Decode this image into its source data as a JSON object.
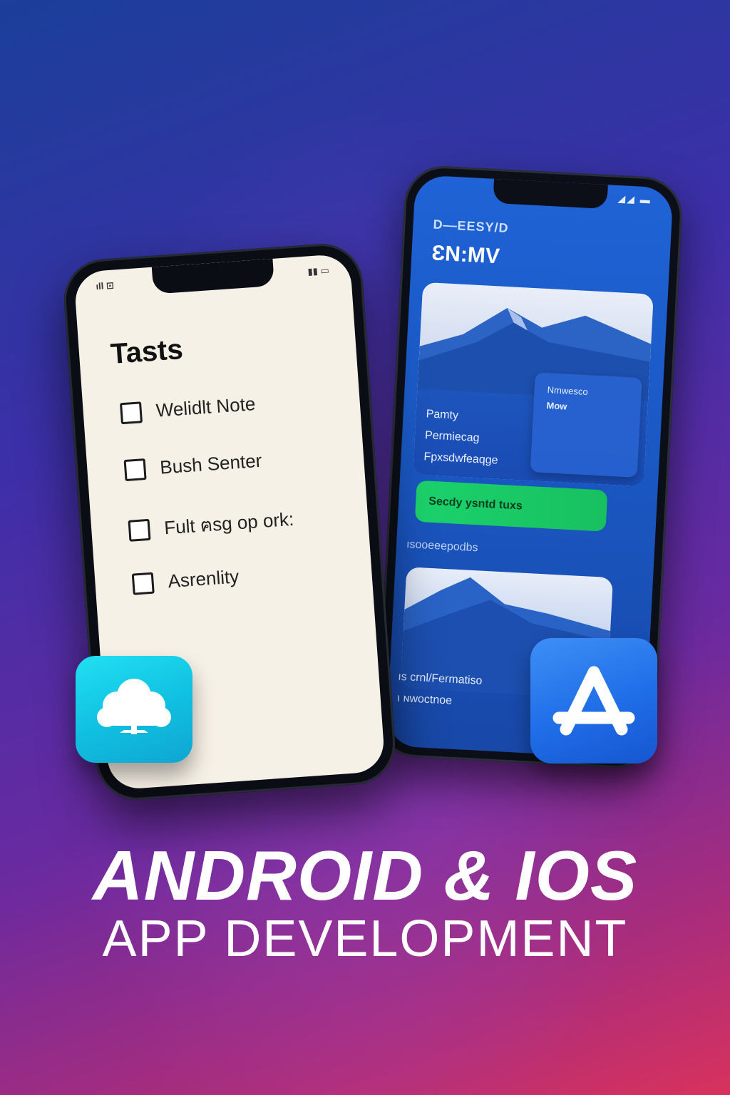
{
  "phone_left": {
    "status_left": "ıll ⊡",
    "status_right": "▮▮ ▭",
    "title": "Tasts",
    "tasks": [
      {
        "label": "Welidlt Note",
        "checked": false
      },
      {
        "label": "Bush Senter",
        "checked": false
      },
      {
        "label": "Fult ฅsg op ork:",
        "checked": false
      },
      {
        "label": "Asrenlity",
        "checked": false
      }
    ]
  },
  "phone_right": {
    "status": "◢◢ ▬",
    "top_label": "D⎯⎯ЕESY/D",
    "title": "ƐN:MV",
    "card": {
      "mini_line1": "Nmwesco",
      "mini_line2": "Mow",
      "lines": [
        "Pamty",
        "Permiecag",
        "Fpxsdwfeaqge"
      ]
    },
    "button_label": "Secdy ysntd tuxs",
    "section_label": "ısooeeepodbs",
    "card2_lines": [
      "ıs crnl/Fermatiso",
      "ı ɴwoctnoe"
    ]
  },
  "icons": {
    "left_app": "cloud-tree-icon",
    "right_app": "app-store-icon"
  },
  "headline": {
    "line1": "ANDROID & IOS",
    "line2": "APP DEVELOPMENT"
  }
}
